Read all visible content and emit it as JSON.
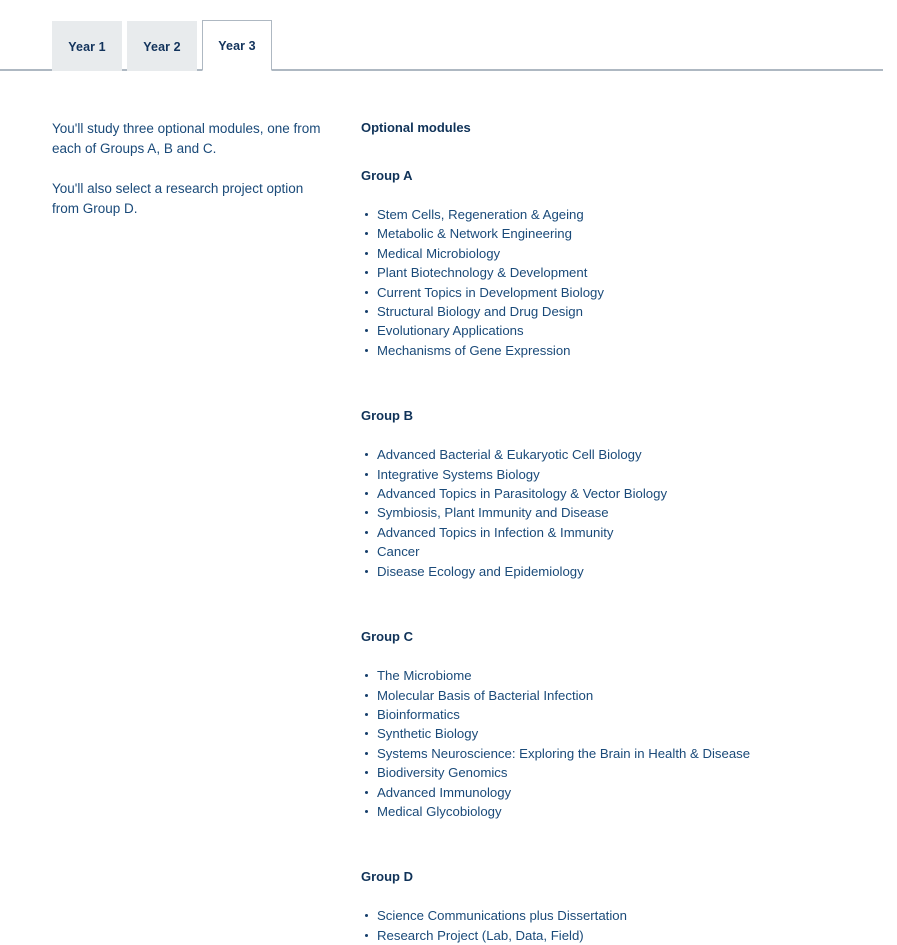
{
  "tabs": [
    {
      "label": "Year 1",
      "active": false
    },
    {
      "label": "Year 2",
      "active": false
    },
    {
      "label": "Year 3",
      "active": true
    }
  ],
  "left_column": {
    "paragraph_1": "You'll study three optional modules, one from each of Groups A, B and C.",
    "paragraph_2": "You'll also select a research project option from Group D."
  },
  "right_column": {
    "section_title": "Optional modules",
    "groups": [
      {
        "title": "Group A",
        "modules": [
          "Stem Cells, Regeneration & Ageing",
          "Metabolic & Network Engineering",
          "Medical Microbiology",
          "Plant Biotechnology & Development",
          "Current Topics in Development Biology",
          "Structural Biology and Drug Design",
          "Evolutionary Applications",
          "Mechanisms of Gene Expression"
        ]
      },
      {
        "title": "Group B",
        "modules": [
          "Advanced Bacterial & Eukaryotic Cell Biology",
          "Integrative Systems Biology",
          "Advanced Topics in Parasitology & Vector Biology",
          "Symbiosis, Plant Immunity and Disease",
          "Advanced Topics in Infection & Immunity",
          "Cancer",
          "Disease Ecology and Epidemiology"
        ]
      },
      {
        "title": "Group C",
        "modules": [
          "The Microbiome",
          "Molecular Basis of Bacterial Infection",
          "Bioinformatics",
          "Synthetic Biology",
          "Systems Neuroscience: Exploring the Brain in Health & Disease",
          "Biodiversity Genomics",
          "Advanced Immunology",
          "Medical Glycobiology"
        ]
      },
      {
        "title": "Group D",
        "modules": [
          "Science Communications plus Dissertation",
          "Research Project (Lab, Data, Field)"
        ]
      }
    ]
  },
  "colors": {
    "body_text": "#1a4a79",
    "heading": "#0f3258",
    "tab_active_text": "#12335c",
    "tab_inactive_bg": "#e8ebed",
    "rule": "#aeb8c2",
    "page_bg": "#ffffff"
  }
}
